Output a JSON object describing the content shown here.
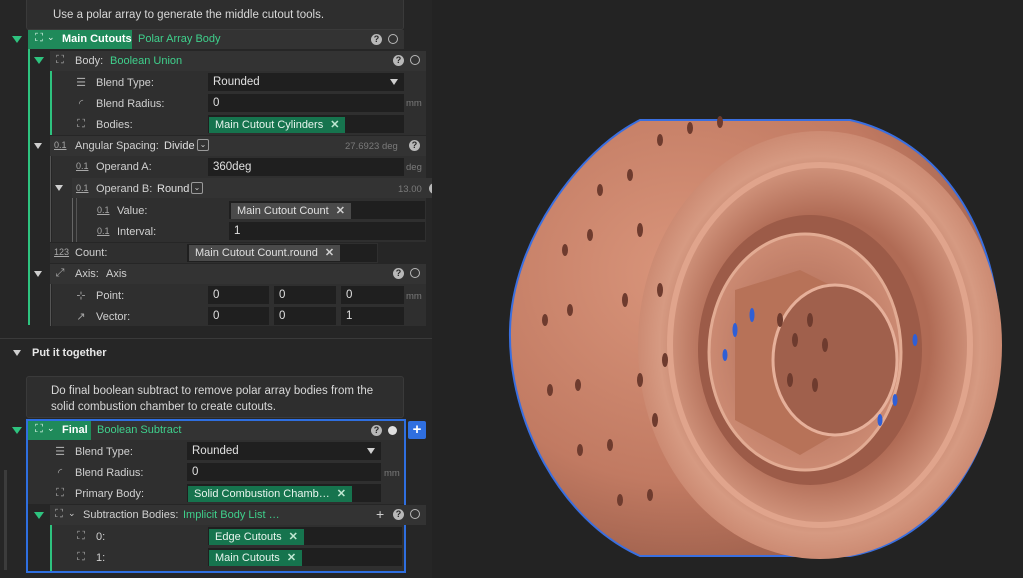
{
  "colors": {
    "accent_green": "#2ec37f",
    "chip_green": "#16744e",
    "selection_blue": "#2f6fe0",
    "body_copper": "#c8836a"
  },
  "intro_note": "Use a polar array to generate the middle cutout tools.",
  "main_cutouts": {
    "name": "Main Cutouts",
    "type": "Polar Array Body",
    "body": {
      "label": "Body:",
      "value": "Boolean Union"
    },
    "blend_type": {
      "label": "Blend Type:",
      "value": "Rounded"
    },
    "blend_radius": {
      "label": "Blend Radius:",
      "value": "0",
      "unit": "mm"
    },
    "bodies": {
      "label": "Bodies:",
      "value": "Main Cutout Cylinders"
    },
    "angular_spacing": {
      "label": "Angular Spacing:",
      "mode": "Divide",
      "result": "27.6923 deg"
    },
    "operand_a": {
      "label": "Operand A:",
      "value": "360deg",
      "unit": "deg"
    },
    "operand_b": {
      "label": "Operand B:",
      "mode": "Round",
      "result": "13.00"
    },
    "value": {
      "label": "Value:",
      "value": "Main Cutout Count"
    },
    "interval": {
      "label": "Interval:",
      "value": "1"
    },
    "count": {
      "label": "Count:",
      "value": "Main Cutout Count.round"
    },
    "axis": {
      "label": "Axis:",
      "value": "Axis"
    },
    "point": {
      "label": "Point:",
      "x": "0",
      "y": "0",
      "z": "0",
      "unit": "mm"
    },
    "vector": {
      "label": "Vector:",
      "x": "0",
      "y": "0",
      "z": "1"
    }
  },
  "section_title": "Put it together",
  "final_note": "Do final boolean subtract to remove polar array bodies from the solid combustion chamber to create cutouts.",
  "final": {
    "name": "Final",
    "type": "Boolean Subtract",
    "blend_type": {
      "label": "Blend Type:",
      "value": "Rounded"
    },
    "blend_radius": {
      "label": "Blend Radius:",
      "value": "0",
      "unit": "mm"
    },
    "primary_body": {
      "label": "Primary Body:",
      "value": "Solid Combustion Chamb…"
    },
    "subtraction": {
      "label": "Subtraction Bodies:",
      "value": "Implicit Body List …"
    },
    "items": [
      {
        "label": "0:",
        "value": "Edge Cutouts"
      },
      {
        "label": "1:",
        "value": "Main Cutouts"
      }
    ]
  },
  "icons": {
    "count_icon": "123",
    "number_icon": "0.1"
  }
}
